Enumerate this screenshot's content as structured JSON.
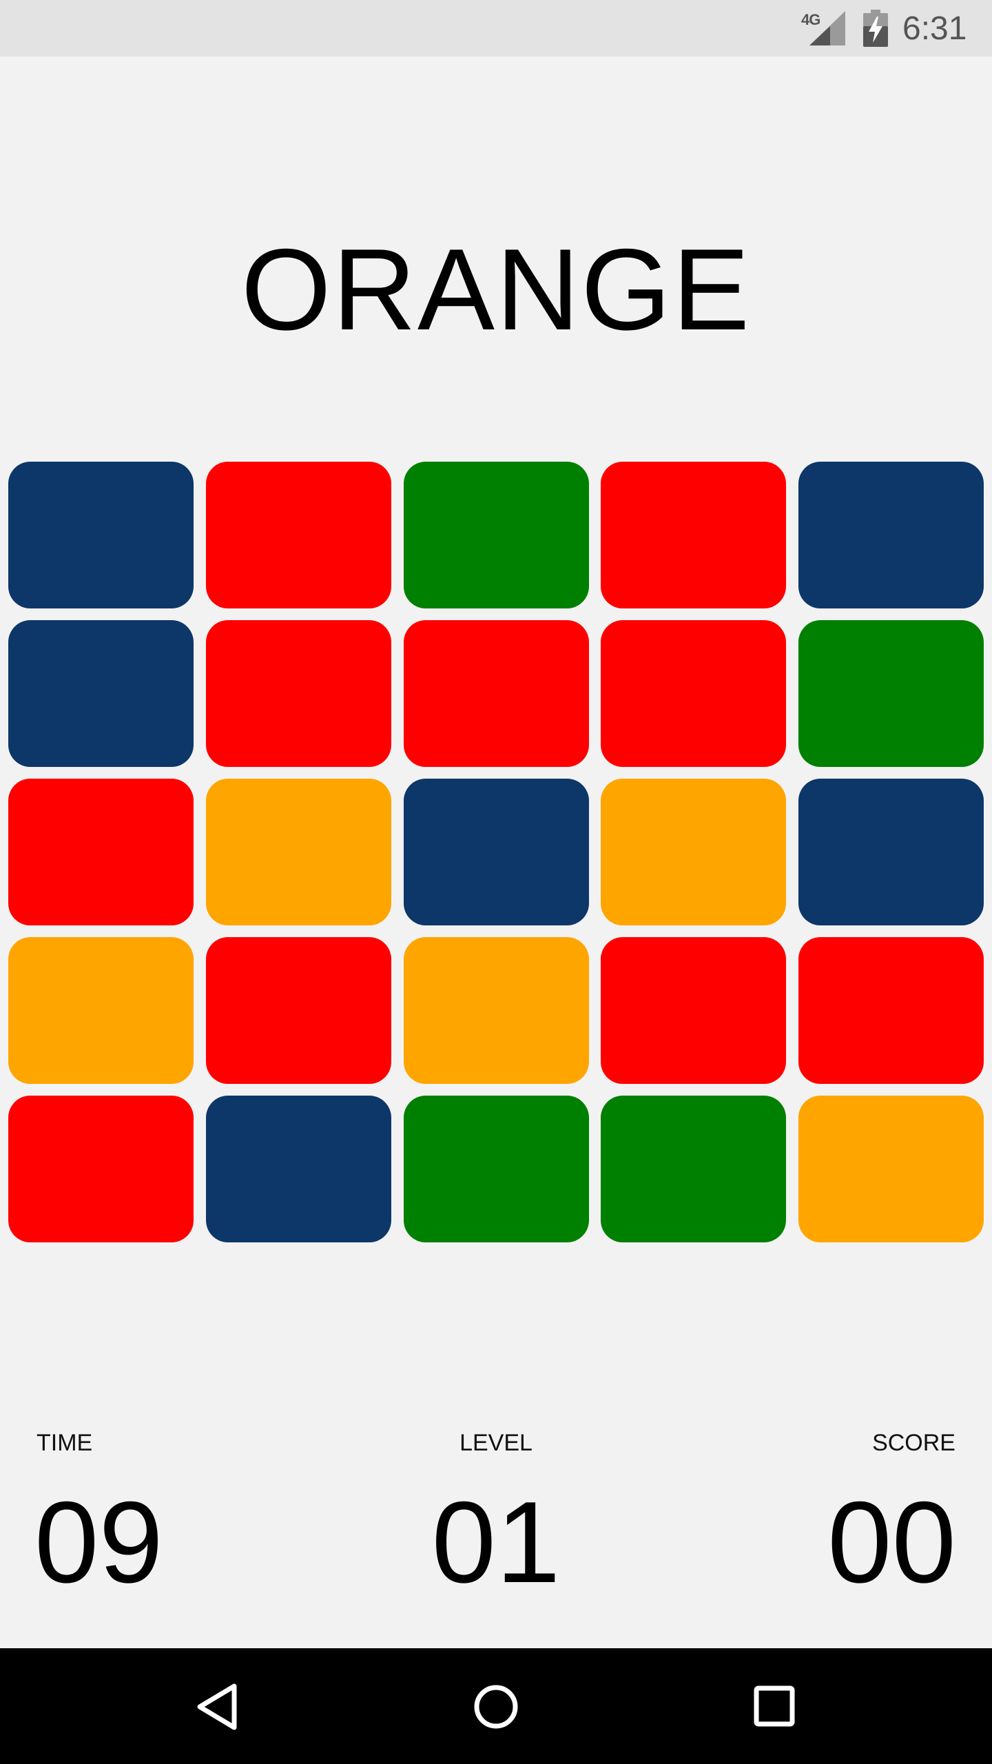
{
  "status_bar": {
    "network": "4G",
    "time": "6:31",
    "icons": [
      "signal-icon",
      "battery-charging-icon"
    ]
  },
  "target_word": "ORANGE",
  "colors": {
    "blue": "#0d3769",
    "red": "#ff0000",
    "green": "#008000",
    "orange": "#ffa500",
    "background": "#f2f2f2"
  },
  "grid": [
    [
      "blue",
      "red",
      "green",
      "red",
      "blue"
    ],
    [
      "blue",
      "red",
      "red",
      "red",
      "green"
    ],
    [
      "red",
      "orange",
      "blue",
      "orange",
      "blue"
    ],
    [
      "orange",
      "red",
      "orange",
      "red",
      "red"
    ],
    [
      "red",
      "blue",
      "green",
      "green",
      "orange"
    ]
  ],
  "stats": {
    "time_label": "TIME",
    "time_value": "09",
    "level_label": "LEVEL",
    "level_value": "01",
    "score_label": "SCORE",
    "score_value": "00"
  },
  "nav": {
    "icons": [
      "back-icon",
      "home-icon",
      "recents-icon"
    ]
  }
}
